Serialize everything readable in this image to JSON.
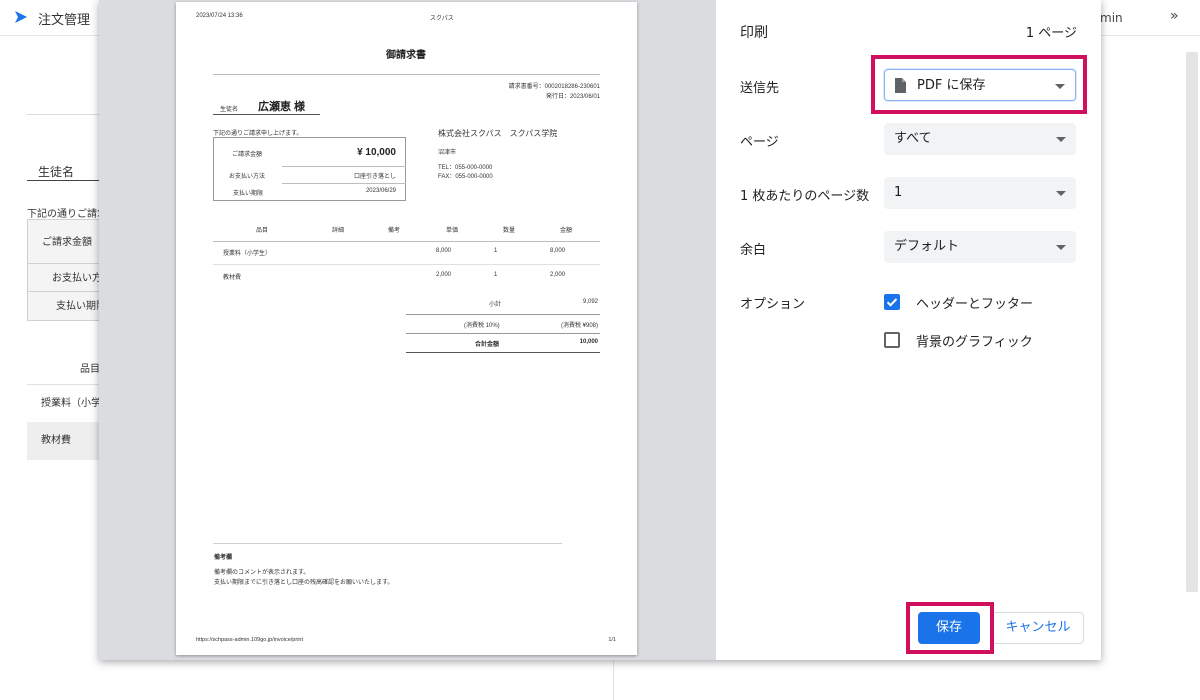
{
  "background": {
    "app_title": "注文管理",
    "admin_fragment": "min",
    "chevron": "»",
    "student_label": "生徒名",
    "note_fragment": "下記の通りご請求",
    "box_labels": [
      "ご請求金額",
      "お支払い方法",
      "支払い期限"
    ],
    "item_header": "品目",
    "rows": [
      "授業料（小学",
      "教材費"
    ]
  },
  "preview": {
    "header_datetime": "2023/07/24 13:36",
    "header_site": "スクパス",
    "doc_title": "御請求書",
    "invoice_number": "請求書番号：0002018286-230601",
    "issue_date": "発行日：2023/06/01",
    "student_label": "生徒名",
    "student_name": "広瀬恵 様",
    "intro": "下記の通りご請求申し上げます。",
    "summary": {
      "amount_label": "ご請求金額",
      "amount_value": "¥ 10,000",
      "method_label": "お支払い方法",
      "method_value": "口座引き落とし",
      "deadline_label": "支払い期限",
      "deadline_value": "2023/06/29"
    },
    "company": {
      "name": "株式会社スクパス　スクパス学院",
      "city": "沼津市",
      "tel": "TEL：055-000-0000",
      "fax": "FAX：055-000-0000"
    },
    "table": {
      "headers": [
        "品目",
        "詳細",
        "備考",
        "単価",
        "数量",
        "金額"
      ],
      "rows": [
        [
          "授業料（小学生）",
          "",
          "",
          "8,000",
          "1",
          "8,000"
        ],
        [
          "教材費",
          "",
          "",
          "2,000",
          "1",
          "2,000"
        ]
      ]
    },
    "totals": {
      "subtotal_label": "小計",
      "subtotal_value": "9,092",
      "tax_label": "(消費税 10%)",
      "tax_value": "(消費税 ¥908)",
      "total_label": "合計金額",
      "total_value": "10,000"
    },
    "remarks": {
      "title": "備考欄",
      "line1": "備考欄のコメントが表示されます。",
      "line2": "支払い期限までに引き落とし口座の残高確認をお願いいたします。"
    },
    "footer_url": "https://schpass-admin.109go.jp/invoice/print",
    "footer_page": "1/1"
  },
  "print": {
    "title": "印刷",
    "page_count": "1 ページ",
    "destination_label": "送信先",
    "destination_value": "PDF に保存",
    "pages_label": "ページ",
    "pages_value": "すべて",
    "pages_per_sheet_label": "1 枚あたりのページ数",
    "pages_per_sheet_value": "1",
    "margins_label": "余白",
    "margins_value": "デフォルト",
    "options_label": "オプション",
    "option_headers_footers": "ヘッダーとフッター",
    "option_headers_footers_checked": true,
    "option_background": "背景のグラフィック",
    "option_background_checked": false,
    "save_button": "保存",
    "cancel_button": "キャンセル"
  },
  "colors": {
    "accent": "#1a73e8",
    "highlight": "#d0105f",
    "preview_bg": "#dadce0"
  },
  "icons": {
    "logo": "app-logo-icon",
    "file": "file-icon",
    "dropdown": "caret-down-icon",
    "check": "check-icon"
  }
}
